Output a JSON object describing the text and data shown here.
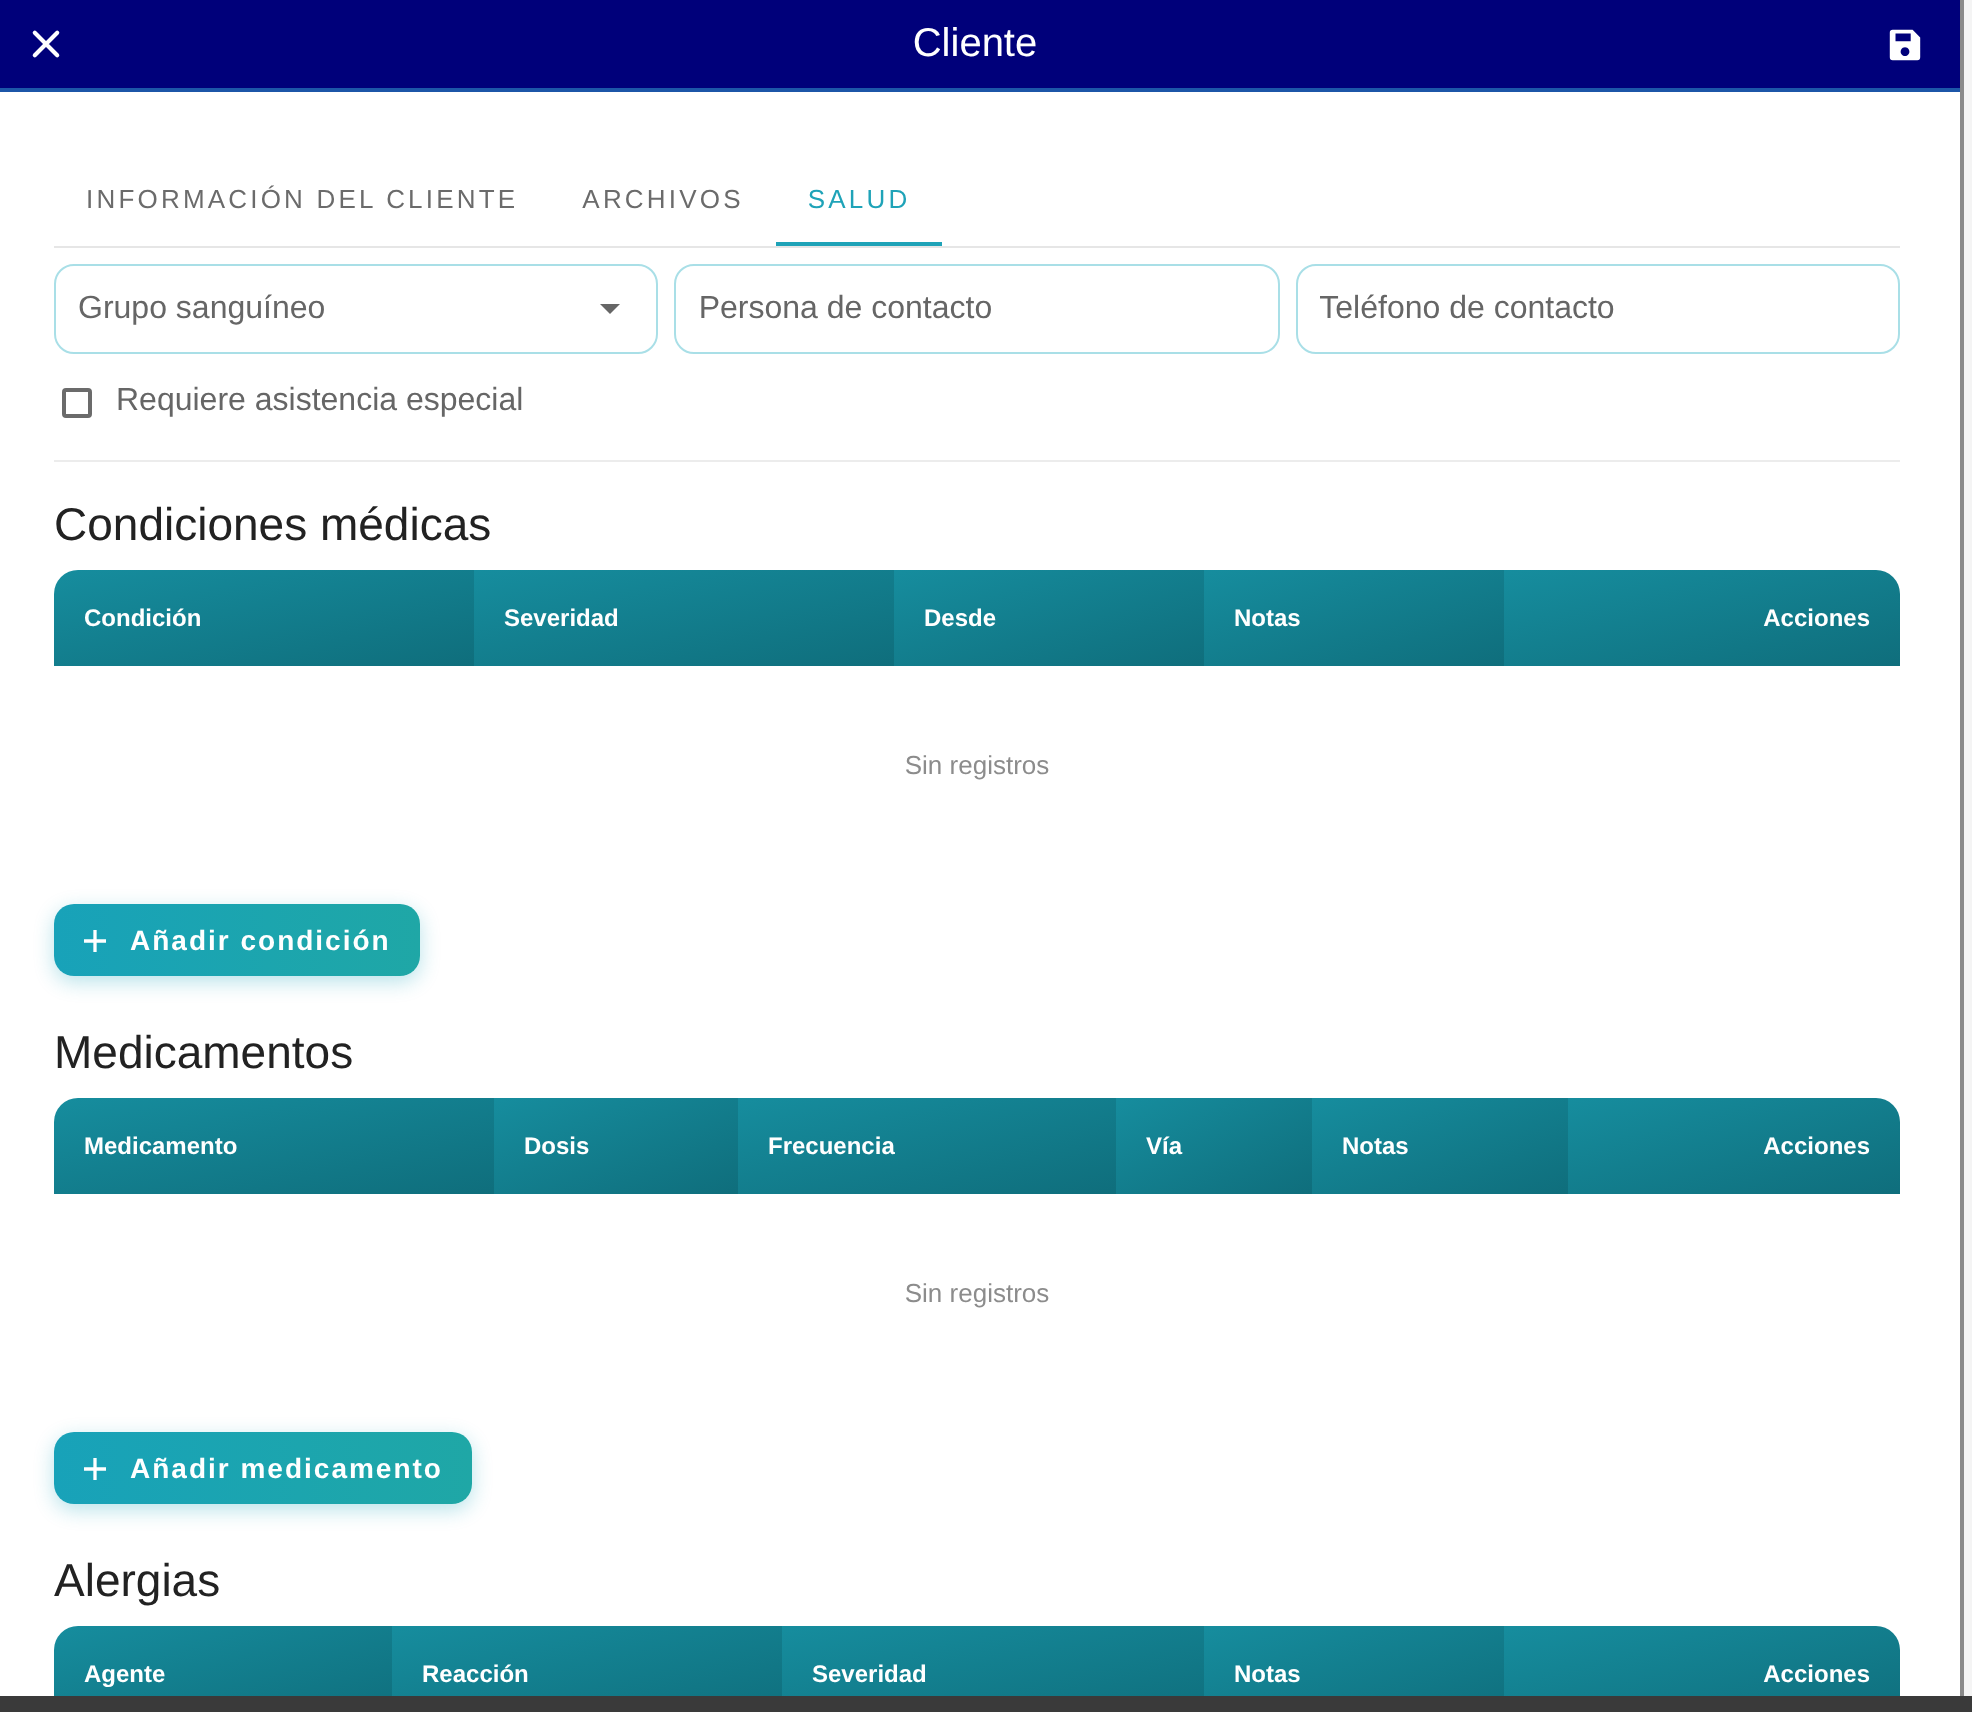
{
  "window": {
    "title": "Cliente"
  },
  "tabs": [
    {
      "label": "INFORMACIÓN DEL CLIENTE",
      "selected": false
    },
    {
      "label": "ARCHIVOS",
      "selected": false
    },
    {
      "label": "SALUD",
      "selected": true
    }
  ],
  "fields": [
    {
      "kind": "select",
      "placeholder": "Grupo sanguíneo"
    },
    {
      "kind": "text",
      "placeholder": "Persona de contacto"
    },
    {
      "kind": "text",
      "placeholder": "Teléfono de contacto"
    }
  ],
  "checkbox": {
    "label": "Requiere asistencia especial",
    "checked": false
  },
  "sections": [
    {
      "title": "Condiciones médicas",
      "table": {
        "columns": [
          "Condición",
          "Severidad",
          "Desde",
          "Notas",
          "Acciones"
        ],
        "empty_text": "Sin registros"
      },
      "add_button": "Añadir condición"
    },
    {
      "title": "Medicamentos",
      "table": {
        "columns": [
          "Medicamento",
          "Dosis",
          "Frecuencia",
          "Vía",
          "Notas",
          "Acciones"
        ],
        "empty_text": "Sin registros"
      },
      "add_button": "Añadir medicamento"
    },
    {
      "title": "Alergias",
      "table": {
        "columns": [
          "Agente",
          "Reacción",
          "Severidad",
          "Notas",
          "Acciones"
        ]
      }
    }
  ]
}
